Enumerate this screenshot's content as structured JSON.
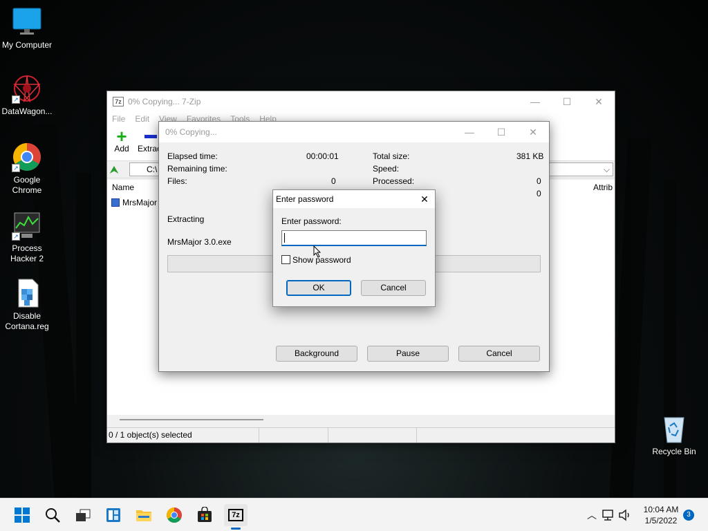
{
  "desktop": {
    "icons": [
      {
        "label": "My Computer"
      },
      {
        "label": "DataWagon..."
      },
      {
        "label": "Google Chrome"
      },
      {
        "label": "Process Hacker 2"
      },
      {
        "label": "Disable Cortana.reg"
      },
      {
        "label": "Recycle Bin"
      }
    ]
  },
  "main_window": {
    "title": "0% Copying... 7-Zip",
    "menu": [
      "File",
      "Edit",
      "View",
      "Favorites",
      "Tools",
      "Help"
    ],
    "toolbar": {
      "add_label": "Add",
      "extract_label": "Extrac"
    },
    "address": "C:\\",
    "columns": {
      "name": "Name",
      "attrib": "Attrib"
    },
    "file_item": "MrsMajor",
    "status": "0 / 1 object(s) selected"
  },
  "progress_dialog": {
    "title": "0% Copying...",
    "elapsed_label": "Elapsed time:",
    "elapsed_value": "00:00:01",
    "remaining_label": "Remaining time:",
    "files_label": "Files:",
    "files_value": "0",
    "total_size_label": "Total size:",
    "total_size_value": "381 KB",
    "speed_label": "Speed:",
    "processed_label": "Processed:",
    "processed_value": "0",
    "extra_value": "0",
    "action": "Extracting",
    "current_file": "MrsMajor 3.0.exe",
    "progress_percent": 0,
    "background_label": "Background",
    "pause_label": "Pause",
    "cancel_label": "Cancel"
  },
  "password_dialog": {
    "title": "Enter password",
    "field_label": "Enter password:",
    "value": "",
    "show_password_label": "Show password",
    "ok_label": "OK",
    "cancel_label": "Cancel"
  },
  "taskbar": {
    "time": "10:04 AM",
    "date": "1/5/2022",
    "notification_count": "3",
    "sevenzip_label": "7z"
  },
  "colors": {
    "accent": "#0067c0",
    "taskbar": "#f3f3f3"
  }
}
